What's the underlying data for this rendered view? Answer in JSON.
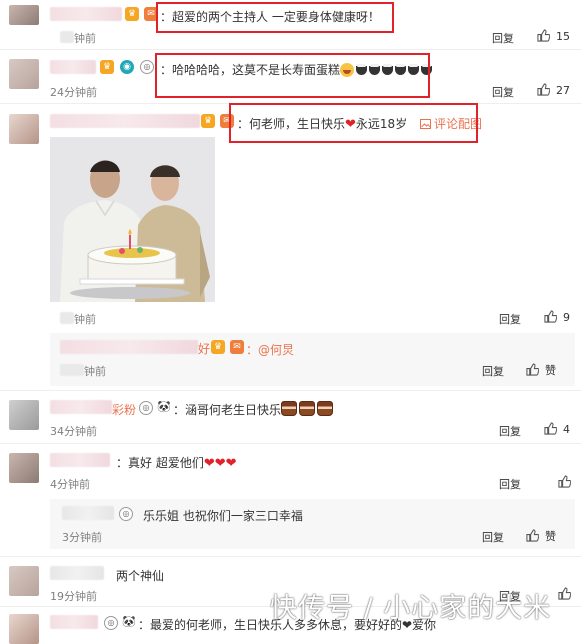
{
  "comments": [
    {
      "text": "：超爱的两个主持人 一定要身体健康呀！",
      "time": "钟前",
      "reply": "回复",
      "likes": "15"
    },
    {
      "text": "：哈哈哈哈，这莫不是长寿面蛋糕",
      "time": "24分钟前",
      "reply": "回复",
      "likes": "27"
    },
    {
      "text": "：何老师，生日快乐",
      "text2": "永远18岁",
      "pic_link": "评论配图",
      "time": "钟前",
      "reply": "回复",
      "likes": "9",
      "nested": {
        "name_tail": "好",
        "text": "：@何炅",
        "time": "钟前",
        "reply": "回复",
        "likes": "赞"
      }
    },
    {
      "name_tail": "彩粉",
      "text": "：涵哥何老生日快乐",
      "time": "34分钟前",
      "reply": "回复",
      "likes": "4"
    },
    {
      "text": "：真好 超爱他们",
      "time": "4分钟前",
      "reply": "回复",
      "likes": "",
      "nested": {
        "text": "乐乐姐 也祝你们一家三口幸福",
        "time": "3分钟前",
        "reply": "回复",
        "likes": "赞"
      }
    },
    {
      "text": "两个神仙",
      "time": "19分钟前",
      "reply": "回复",
      "likes": ""
    },
    {
      "text": "：最爱的何老师，生日快乐人多多休息，要好好的❤爱你"
    }
  ],
  "watermark": "快传号 / 小心家的大米",
  "colors": {
    "highlight_border": "#e0232b",
    "link": "#eb7350",
    "time": "#808080"
  }
}
